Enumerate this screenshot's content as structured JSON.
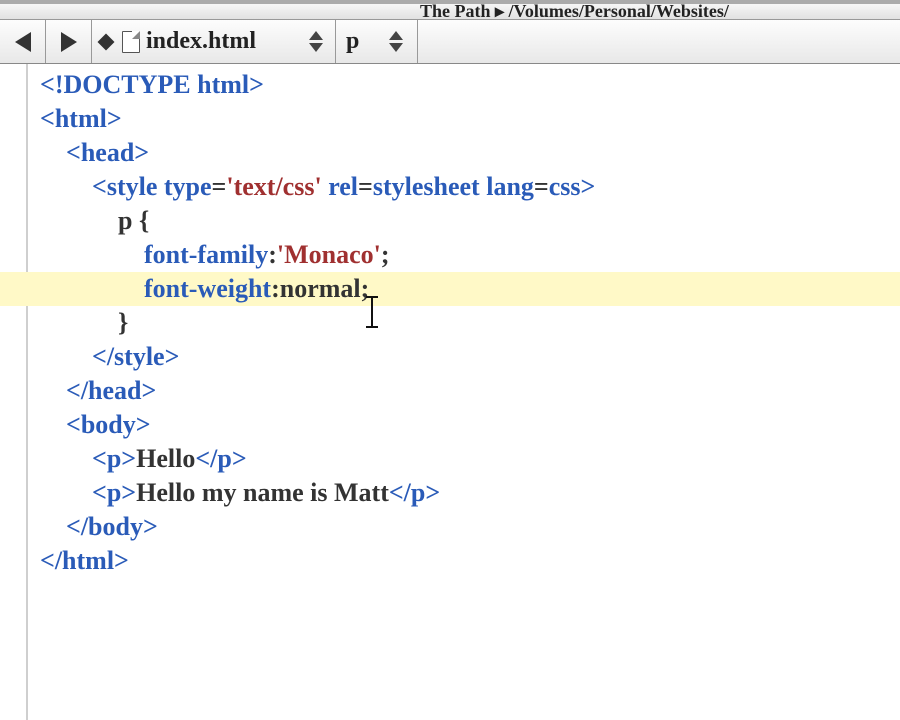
{
  "pathbar": {
    "text": "The Path ▸ /Volumes/Personal/Websites/"
  },
  "toolbar": {
    "filename": "index.html",
    "crumb": "p"
  },
  "code": {
    "lines": [
      {
        "indent": 0,
        "parts": [
          {
            "t": "<!",
            "c": "kw"
          },
          {
            "t": "DOCTYPE html",
            "c": "kw"
          },
          {
            "t": ">",
            "c": "kw"
          }
        ]
      },
      {
        "indent": 0,
        "parts": [
          {
            "t": "<",
            "c": "kw"
          },
          {
            "t": "html",
            "c": "kw"
          },
          {
            "t": ">",
            "c": "kw"
          }
        ]
      },
      {
        "indent": 1,
        "parts": [
          {
            "t": "<",
            "c": "kw"
          },
          {
            "t": "head",
            "c": "kw"
          },
          {
            "t": ">",
            "c": "kw"
          }
        ]
      },
      {
        "indent": 2,
        "parts": [
          {
            "t": "<",
            "c": "kw"
          },
          {
            "t": "style",
            "c": "kw"
          },
          {
            "t": " ",
            "c": ""
          },
          {
            "t": "type",
            "c": "attr"
          },
          {
            "t": "=",
            "c": ""
          },
          {
            "t": "'text/css'",
            "c": "str"
          },
          {
            "t": " ",
            "c": ""
          },
          {
            "t": "rel",
            "c": "attr"
          },
          {
            "t": "=",
            "c": ""
          },
          {
            "t": "stylesheet",
            "c": "attr"
          },
          {
            "t": " ",
            "c": ""
          },
          {
            "t": "lang",
            "c": "attr"
          },
          {
            "t": "=",
            "c": ""
          },
          {
            "t": "css",
            "c": "attr"
          },
          {
            "t": ">",
            "c": "kw"
          }
        ]
      },
      {
        "indent": 3,
        "parts": [
          {
            "t": "p {",
            "c": ""
          }
        ]
      },
      {
        "indent": 4,
        "parts": [
          {
            "t": "font-family",
            "c": "attr"
          },
          {
            "t": ":",
            "c": ""
          },
          {
            "t": "'Monaco'",
            "c": "str"
          },
          {
            "t": ";",
            "c": ""
          }
        ]
      },
      {
        "indent": 4,
        "highlight": true,
        "caret": true,
        "parts": [
          {
            "t": "font-weight",
            "c": "attr"
          },
          {
            "t": ":",
            "c": ""
          },
          {
            "t": "normal",
            "c": ""
          },
          {
            "t": ";",
            "c": ""
          }
        ]
      },
      {
        "indent": 3,
        "parts": [
          {
            "t": "}",
            "c": ""
          }
        ]
      },
      {
        "indent": 2,
        "parts": [
          {
            "t": "</",
            "c": "kw"
          },
          {
            "t": "style",
            "c": "kw"
          },
          {
            "t": ">",
            "c": "kw"
          }
        ]
      },
      {
        "indent": 1,
        "parts": [
          {
            "t": "</",
            "c": "kw"
          },
          {
            "t": "head",
            "c": "kw"
          },
          {
            "t": ">",
            "c": "kw"
          }
        ]
      },
      {
        "indent": 1,
        "parts": [
          {
            "t": "<",
            "c": "kw"
          },
          {
            "t": "body",
            "c": "kw"
          },
          {
            "t": ">",
            "c": "kw"
          }
        ]
      },
      {
        "indent": 2,
        "parts": [
          {
            "t": "<",
            "c": "kw"
          },
          {
            "t": "p",
            "c": "kw"
          },
          {
            "t": ">",
            "c": "kw"
          },
          {
            "t": "Hello",
            "c": ""
          },
          {
            "t": "</",
            "c": "kw"
          },
          {
            "t": "p",
            "c": "kw"
          },
          {
            "t": ">",
            "c": "kw"
          }
        ]
      },
      {
        "indent": 2,
        "parts": [
          {
            "t": "<",
            "c": "kw"
          },
          {
            "t": "p",
            "c": "kw"
          },
          {
            "t": ">",
            "c": "kw"
          },
          {
            "t": "Hello my name is Matt",
            "c": ""
          },
          {
            "t": "</",
            "c": "kw"
          },
          {
            "t": "p",
            "c": "kw"
          },
          {
            "t": ">",
            "c": "kw"
          }
        ]
      },
      {
        "indent": 1,
        "parts": [
          {
            "t": "</",
            "c": "kw"
          },
          {
            "t": "body",
            "c": "kw"
          },
          {
            "t": ">",
            "c": "kw"
          }
        ]
      },
      {
        "indent": 0,
        "parts": [
          {
            "t": "</",
            "c": "kw"
          },
          {
            "t": "html",
            "c": "kw"
          },
          {
            "t": ">",
            "c": "kw"
          }
        ]
      }
    ]
  }
}
